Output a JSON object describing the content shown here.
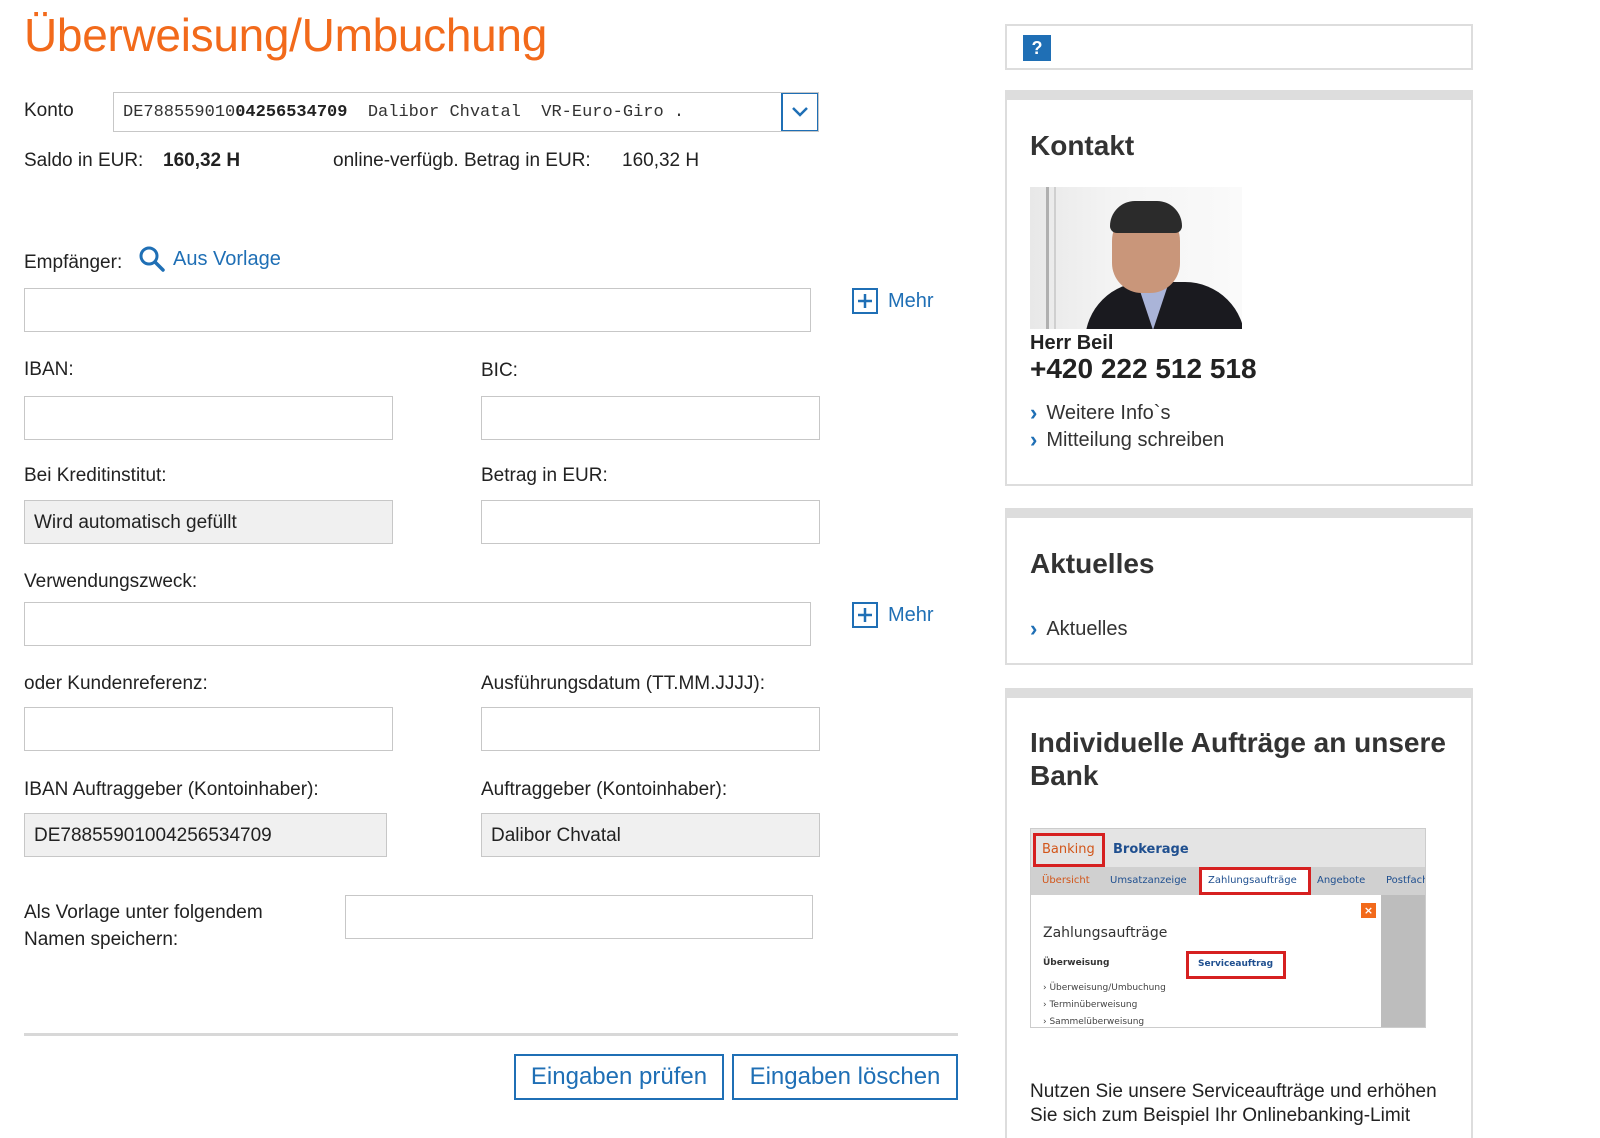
{
  "page": {
    "title": "Überweisung/Umbuchung"
  },
  "konto": {
    "label": "Konto",
    "value_prefix": "DE788559010",
    "value_bold": "04256534709",
    "value_suffix": "  Dalibor Chvatal  VR-Euro-Giro ."
  },
  "saldo": {
    "label": "Saldo in EUR:",
    "value": "160,32 H",
    "available_label": "online-verfügb. Betrag in EUR:",
    "available_value": "160,32 H"
  },
  "form": {
    "empfaenger_label": "Empfänger:",
    "aus_vorlage": "Aus Vorlage",
    "mehr": "Mehr",
    "iban_label": "IBAN:",
    "bic_label": "BIC:",
    "kreditinstitut_label": "Bei Kreditinstitut:",
    "kreditinstitut_value": "Wird automatisch gefüllt",
    "betrag_label": "Betrag in EUR:",
    "verwendungszweck_label": "Verwendungszweck:",
    "kundenreferenz_label": "oder Kundenreferenz:",
    "ausfuehrungsdatum_label": "Ausführungsdatum (TT.MM.JJJJ):",
    "iban_auftraggeber_label": "IBAN Auftraggeber (Kontoinhaber):",
    "iban_auftraggeber_value": "DE78855901004256534709",
    "auftraggeber_label": "Auftraggeber (Kontoinhaber):",
    "auftraggeber_value": "Dalibor Chvatal",
    "vorlage_label_line1": "Als Vorlage unter folgendem",
    "vorlage_label_line2": "Namen speichern:"
  },
  "buttons": {
    "pruefen": "Eingaben prüfen",
    "loeschen": "Eingaben löschen"
  },
  "help": {
    "icon_text": "?"
  },
  "kontakt": {
    "heading": "Kontakt",
    "name": "Herr Beil",
    "phone": "+420 222 512 518",
    "links": [
      "Weitere Info`s",
      "Mitteilung schreiben"
    ]
  },
  "aktuelles": {
    "heading": "Aktuelles",
    "link": "Aktuelles"
  },
  "individuell": {
    "heading_line1": "Individuelle Aufträge an unsere",
    "heading_line2": "Bank",
    "text": "Nutzen Sie unsere Serviceaufträge und erhöhen",
    "text_line2": "Sie sich zum Beispiel Ihr Onlinebanking-Limit",
    "preview": {
      "tab_banking": "Banking",
      "tab_brokerage": "Brokerage",
      "nav": [
        "Übersicht",
        "Umsatzanzeige",
        "Zahlungsaufträge",
        "Angebote",
        "Postfach"
      ],
      "heading": "Zahlungsaufträge",
      "section": "Überweisung",
      "service": "Serviceauftrag",
      "items": [
        "Überweisung/Umbuchung",
        "Terminüberweisung",
        "Sammelüberweisung"
      ]
    }
  },
  "colors": {
    "accent": "#f26a1b",
    "link": "#1f6fb5"
  }
}
